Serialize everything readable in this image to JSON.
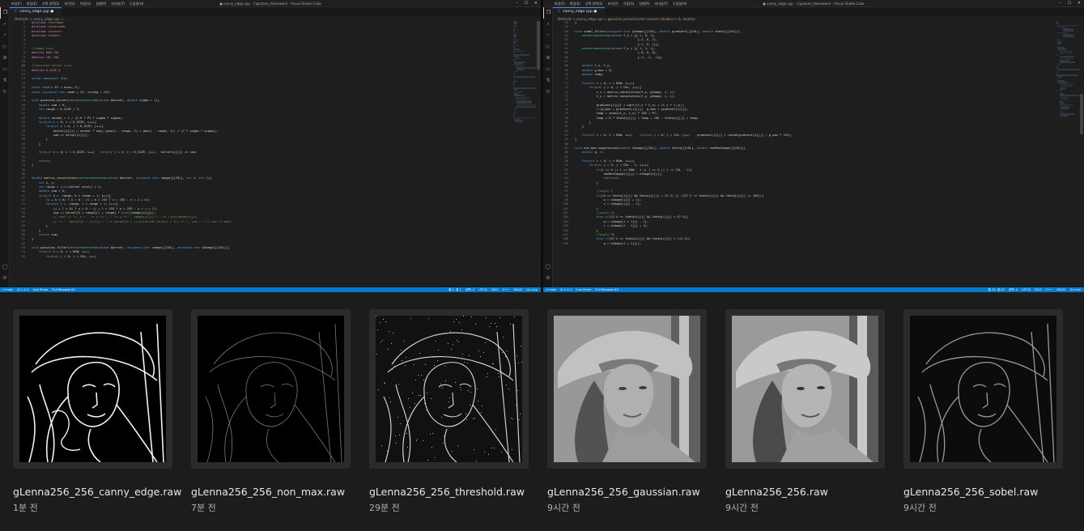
{
  "left_window": {
    "menus": [
      "파일(F)",
      "편집(E)",
      "선택 영역(S)",
      "보기(V)",
      "이동(G)",
      "실행(R)",
      "터미널(T)",
      "도움말(H)"
    ],
    "title": "● canny_edge.cpp - Capstone_Homework - Visual Studio Code",
    "tab_label": "canny_edge.cpp",
    "breadcrumb": "Methods > canny_edge.cpp > ...",
    "status_left": [
      "⎇ main",
      "⊗ 0 ⚠ 0",
      "Live Share",
      "Pull Request #5"
    ],
    "status_right": [
      "줄 1, 열 1",
      "공백: 4",
      "UTF-8",
      "CRLF",
      "C++",
      "Win32",
      "Go Live"
    ],
    "code_lines": [
      {
        "n": "1",
        "t": "#include <fstream>"
      },
      {
        "n": "2",
        "t": "#include <iostream>"
      },
      {
        "n": "3",
        "t": "#include <vector>"
      },
      {
        "n": "4",
        "t": "#include <cmath>"
      },
      {
        "n": "5",
        "t": ""
      },
      {
        "n": "6",
        "t": ""
      },
      {
        "n": "7",
        "t": "//image size"
      },
      {
        "n": "8",
        "t": "#define ROW 256"
      },
      {
        "n": "9",
        "t": "#define COL 256"
      },
      {
        "n": "10",
        "t": ""
      },
      {
        "n": "11",
        "t": "//Gaussian kernel size"
      },
      {
        "n": "12",
        "t": "#define K_SIZE 5"
      },
      {
        "n": "13",
        "t": ""
      },
      {
        "n": "14",
        "t": "using namespace std;"
      },
      {
        "n": "15",
        "t": ""
      },
      {
        "n": "16",
        "t": "const double PI = acos(-1);"
      },
      {
        "n": "17",
        "t": "const unsigned char weak = 25, strong = 255;"
      },
      {
        "n": "18",
        "t": ""
      },
      {
        "n": "19",
        "t": "void gaussian_kernel(vector<vector<double>> &kernel, double sigma = 1){"
      },
      {
        "n": "20",
        "t": "    double sum = 0;"
      },
      {
        "n": "21",
        "t": "    int range = K_SIZE / 2;"
      },
      {
        "n": "22",
        "t": ""
      },
      {
        "n": "23",
        "t": "    double normal = 1 / (2.0 * PI * sigma * sigma);"
      },
      {
        "n": "24",
        "t": "    for(int i = 0; i < K_SIZE; i++){"
      },
      {
        "n": "25",
        "t": "        for(int j = 0; j < K_SIZE; j++){"
      },
      {
        "n": "26",
        "t": "            kernel[i][j] = normal * exp(-(pow(i - range, 2) + pow(j - range, 2)) / (2 * sigma * sigma));"
      },
      {
        "n": "27",
        "t": "            sum += kernel[i][j];"
      },
      {
        "n": "28",
        "t": "        }"
      },
      {
        "n": "29",
        "t": "    }"
      },
      {
        "n": "30",
        "t": ""
      },
      {
        "n": "31",
        "t": "    for(int i = 0; i < K_SIZE; i++)   for(int j = 0; j < K_SIZE; j++)   kernel[i][j] /= sum;"
      },
      {
        "n": "32",
        "t": ""
      },
      {
        "n": "33",
        "t": "    return;"
      },
      {
        "n": "34",
        "t": "}"
      },
      {
        "n": "35",
        "t": ""
      },
      {
        "n": "36",
        "t": ""
      },
      {
        "n": "37",
        "t": "double matrix_convolution(vector<vector<double>> &kernel, unsigned char image[][COL], int i, int j){"
      },
      {
        "n": "38",
        "t": "    int x, y;"
      },
      {
        "n": "39",
        "t": "    int range = (int)kernel.size() / 2;"
      },
      {
        "n": "40",
        "t": "    double sum = 0;"
      },
      {
        "n": "41",
        "t": "    for(int k = -range; k < range + 1; k++){"
      },
      {
        "n": "42",
        "t": "        (i + k < 0) ? x = 0 : (i + k > 255 ? x = 255 : x = i + k);"
      },
      {
        "n": "43",
        "t": "        for(int l = -range; l < range + 1; l++){"
      },
      {
        "n": "44",
        "t": "            (j + l < 0) ? y = 0 : (j + l > 255 ? y = 255 : y = j + l);"
      },
      {
        "n": "45",
        "t": "            sum += kernel[k + range][l + range] * (int)(image[x][y]);"
      },
      {
        "n": "46",
        "t": "            // cout << \"x, y = \" << x << \", \" << y << \"  image[x][y] = \" << (int)image[x][y]"
      },
      {
        "n": "47",
        "t": "            // << \"  kernel[k + (1/2)] = \" << kernel[k + ((int)kernel.size() / 2)] << \"  sum = \" << sum << endl;"
      },
      {
        "n": "48",
        "t": "        }"
      },
      {
        "n": "49",
        "t": "    }"
      },
      {
        "n": "50",
        "t": "    return sum;"
      },
      {
        "n": "51",
        "t": "}"
      },
      {
        "n": "52",
        "t": ""
      },
      {
        "n": "53",
        "t": "void gaussian_filter(vector<vector<double>> &kernel, unsigned char image[][COL], unsigned char gImage[][COL]){"
      },
      {
        "n": "54",
        "t": "    for(int i = 0; i < ROW; i++)"
      },
      {
        "n": "55",
        "t": "        for(int j = 0; j < COL; j++)"
      }
    ]
  },
  "right_window": {
    "menus": [
      "파일(F)",
      "편집(E)",
      "선택 영역(S)",
      "보기(V)",
      "이동(G)",
      "실행(R)",
      "터미널(T)",
      "도움말(H)"
    ],
    "title": "● canny_edge.cpp - Capstone_Homework - Visual Studio Code",
    "tab_label": "canny_edge.cpp",
    "breadcrumb": "Methods > canny_edge.cpp > gaussian_kernel(vector<vector<double>> &, double)",
    "status_left": [
      "⎇ main",
      "⊗ 0 ⚠ 0",
      "Live Share",
      "Pull Request #5"
    ],
    "status_right": [
      "줄 24, 열 42",
      "공백: 4",
      "UTF-8",
      "CRLF",
      "C++",
      "Win32",
      "Go Live"
    ],
    "code_lines": [
      {
        "n": "58",
        "t": "}"
      },
      {
        "n": "59",
        "t": ""
      },
      {
        "n": "60",
        "t": "void sobel_filter(unsigned char gImage[][COL], double gradient[][COL], double theta[][COL]){"
      },
      {
        "n": "61",
        "t": "    vector<vector<double>> f_x = {{-1, 0, 1},"
      },
      {
        "n": "62",
        "t": "                                   {-2, 0, 2},"
      },
      {
        "n": "63",
        "t": "                                   {-1, 0, 1}};"
      },
      {
        "n": "64",
        "t": "    vector<vector<double>> f_y = {{ 1, 2, 1},"
      },
      {
        "n": "65",
        "t": "                                   { 0, 0, 0},"
      },
      {
        "n": "66",
        "t": "                                   {-1, -2, -1}};"
      },
      {
        "n": "67",
        "t": ""
      },
      {
        "n": "68",
        "t": "    double t_x, t_y;"
      },
      {
        "n": "69",
        "t": "    double g_max = 0;"
      },
      {
        "n": "70",
        "t": "    double temp;"
      },
      {
        "n": "71",
        "t": ""
      },
      {
        "n": "72",
        "t": "    for(int i = 0; i < ROW; i++){"
      },
      {
        "n": "73",
        "t": "        for(int j = 0; j < COL; j++){"
      },
      {
        "n": "74",
        "t": "            t_x = matrix_convolution(f_x, gImage, i, j);"
      },
      {
        "n": "75",
        "t": "            t_y = matrix_convolution(f_y, gImage, i, j);"
      },
      {
        "n": "76",
        "t": ""
      },
      {
        "n": "77",
        "t": "            gradient[i][j] = sqrt((t_x * t_x) + (t_y * t_y));"
      },
      {
        "n": "78",
        "t": "            if(g_max < gradient[i][j])  g_max = gradient[i][j];"
      },
      {
        "n": "79",
        "t": "            temp = atan2(t_y, t_x) * 180 / PI;"
      },
      {
        "n": "80",
        "t": "            temp < 0 ? theta[i][j] = temp + 180 : theta[i][j] = temp;"
      },
      {
        "n": "81",
        "t": "        }"
      },
      {
        "n": "82",
        "t": "    }"
      },
      {
        "n": "83",
        "t": ""
      },
      {
        "n": "84",
        "t": "    for(int i = 0; i < ROW; i++)    for(int j = 0; j < COL; j++)    gradient[i][j] = round(gradient[i][j] / g_max * 255);"
      },
      {
        "n": "85",
        "t": "}"
      },
      {
        "n": "86",
        "t": ""
      },
      {
        "n": "87",
        "t": "void non_max_suppression(double nImage[][COL], double theta[][COL], double nonMaxImage[][COL]){"
      },
      {
        "n": "88",
        "t": "    double q, r;"
      },
      {
        "n": "89",
        "t": ""
      },
      {
        "n": "90",
        "t": "    for(int i = 0; i < ROW; i++){"
      },
      {
        "n": "91",
        "t": "        for(int j = 0; j < COL - 1; j++){"
      },
      {
        "n": "92",
        "t": "            if(i == 0 || i == ROW - 1 || j == 0 || j == COL - 1){"
      },
      {
        "n": "93",
        "t": "                nonMaxImage[i][j] = nImage[i][j];"
      },
      {
        "n": "94",
        "t": "                continue;"
      },
      {
        "n": "95",
        "t": "            }"
      },
      {
        "n": "96",
        "t": ""
      },
      {
        "n": "97",
        "t": "            //angle 0"
      },
      {
        "n": "98",
        "t": "            if((0 <= theta[i][j] && theta[i][j] < 22.5) || (157.5 <= theta[i][j] && theta[i][j] <= 180)){"
      },
      {
        "n": "99",
        "t": "                q = nImage[i][j + 1];"
      },
      {
        "n": "100",
        "t": "                r = nImage[i][j - 1];"
      },
      {
        "n": "101",
        "t": "            }"
      },
      {
        "n": "102",
        "t": "            //angle 45"
      },
      {
        "n": "103",
        "t": "            else if(22.5 <= theta[i][j] && theta[i][j] < 67.5){"
      },
      {
        "n": "104",
        "t": "                q = nImage[i + 1][j - 1];"
      },
      {
        "n": "105",
        "t": "                r = nImage[i - 1][j + 1];"
      },
      {
        "n": "106",
        "t": "            }"
      },
      {
        "n": "107",
        "t": "            //angle 90"
      },
      {
        "n": "108",
        "t": "            else if(67.5 <= theta[i][j] && theta[i][j] < 112.5){"
      },
      {
        "n": "109",
        "t": "                q = nImage[i + 1][j];"
      }
    ]
  },
  "gallery": [
    {
      "name": "gLenna256_256_canny_edge.raw",
      "time": "1분 전",
      "style": "canny"
    },
    {
      "name": "gLenna256_256_non_max.raw",
      "time": "7분 전",
      "style": "nonmax"
    },
    {
      "name": "gLenna256_256_threshold.raw",
      "time": "29분 전",
      "style": "threshold"
    },
    {
      "name": "gLenna256_256_gaussian.raw",
      "time": "9시간 전",
      "style": "gaussian"
    },
    {
      "name": "gLenna256_256.raw",
      "time": "9시간 전",
      "style": "original"
    },
    {
      "name": "gLenna256_256_sobel.raw",
      "time": "9시간 전",
      "style": "sobel"
    }
  ],
  "colors": {
    "status_bar": "#007acc",
    "editor_bg": "#1e1e1e",
    "gallery_bg": "#1c1c1c"
  }
}
